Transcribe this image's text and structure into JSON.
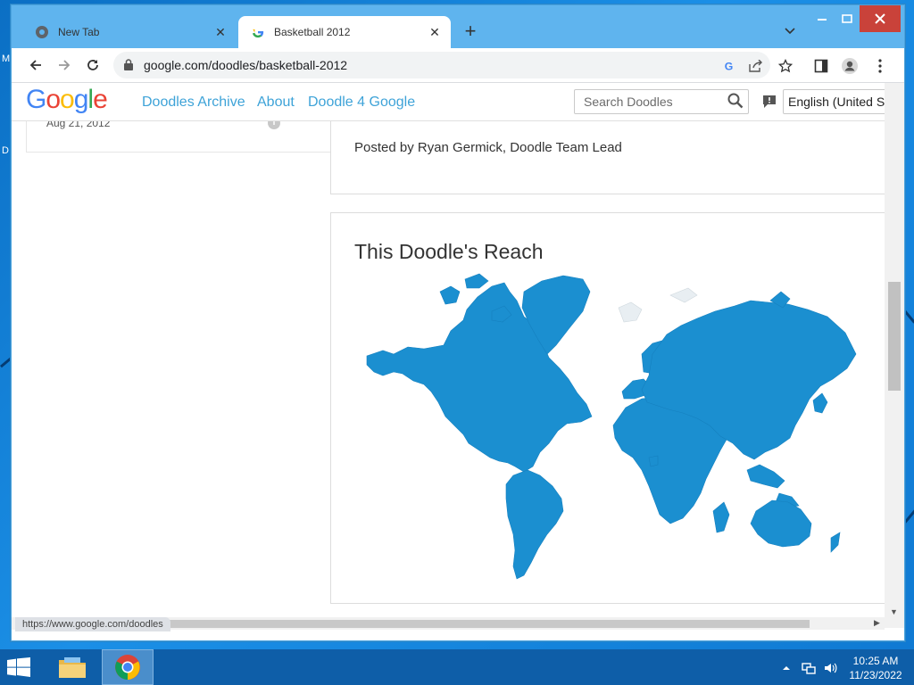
{
  "browser": {
    "tabs": [
      {
        "label": "New Tab",
        "active": false
      },
      {
        "label": "Basketball 2012",
        "active": true
      }
    ],
    "url": "google.com/doodles/basketball-2012",
    "status_url": "https://www.google.com/doodles"
  },
  "header": {
    "logo_text": "Google",
    "nav": [
      "Doodles Archive",
      "About",
      "Doodle 4 Google"
    ],
    "search_placeholder": "Search Doodles",
    "language": "English (United States)"
  },
  "left_card": {
    "date": "Aug 21, 2012"
  },
  "post": {
    "posted_by": "Posted by Ryan Germick, Doodle Team Lead"
  },
  "reach": {
    "title": "This Doodle's Reach",
    "map_color": "#1b8fd0",
    "map_icon": "world-map"
  },
  "taskbar": {
    "time": "10:25 AM",
    "date": "11/23/2022"
  },
  "desktop": {
    "letters": [
      "M",
      "D"
    ]
  },
  "colors": {
    "titlebar": "#5fb4ee",
    "link": "#3ea3d8",
    "taskbar": "#0e5ea8",
    "map": "#1b8fd0"
  }
}
